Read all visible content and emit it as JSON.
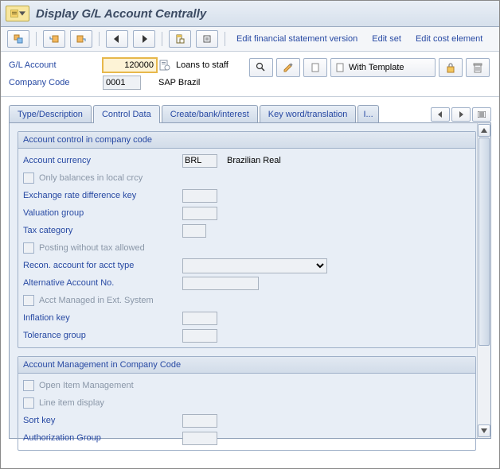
{
  "title": "Display G/L Account Centrally",
  "toolbar": {
    "links": {
      "fsv": "Edit financial statement version",
      "set": "Edit set",
      "cost": "Edit cost element"
    }
  },
  "header": {
    "gl_label": "G/L Account",
    "gl_value": "120000",
    "gl_desc": "Loans to staff",
    "cc_label": "Company Code",
    "cc_value": "0001",
    "cc_desc": "SAP Brazil",
    "with_template": "With Template"
  },
  "tabs": {
    "t1": "Type/Description",
    "t2": "Control Data",
    "t3": "Create/bank/interest",
    "t4": "Key word/translation",
    "t5": "I..."
  },
  "group1": {
    "title": "Account control in company code",
    "currency_lbl": "Account currency",
    "currency_val": "BRL",
    "currency_desc": "Brazilian Real",
    "only_bal": "Only balances in local crcy",
    "exrate": "Exchange rate difference key",
    "valgrp": "Valuation group",
    "taxcat": "Tax category",
    "post_no_tax": "Posting without tax allowed",
    "recon": "Recon. account for acct type",
    "altacct": "Alternative Account No.",
    "extmgd": "Acct Managed in Ext. System",
    "infl": "Inflation key",
    "tolgrp": "Tolerance group"
  },
  "group2": {
    "title": "Account Management in Company Code",
    "openitem": "Open Item Management",
    "lineitem": "Line item display",
    "sortkey": "Sort key",
    "authgrp": "Authorization Group"
  }
}
